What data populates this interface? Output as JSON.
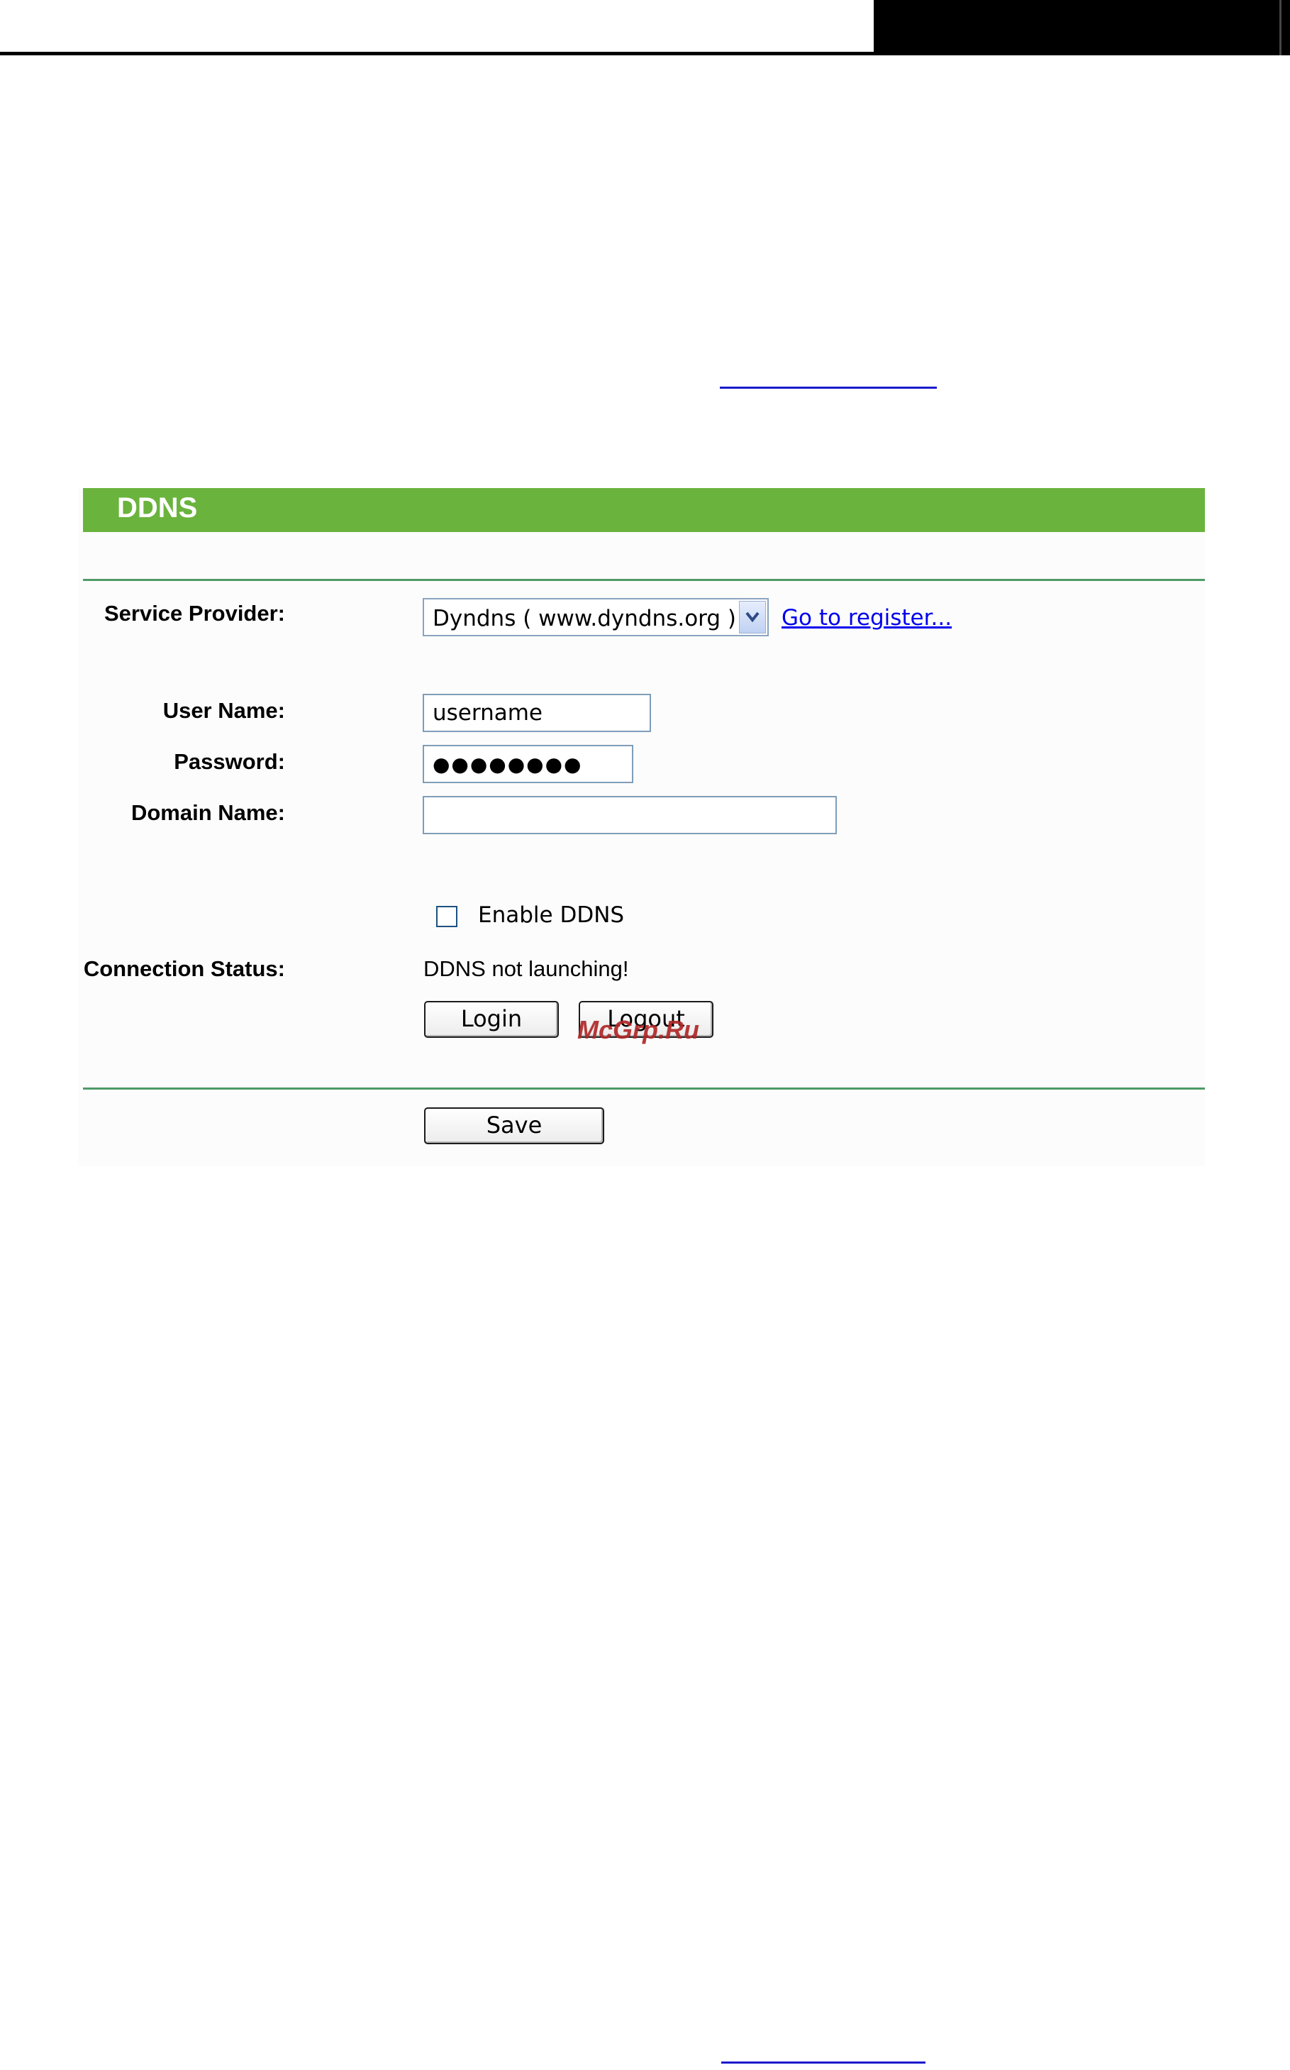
{
  "panel": {
    "title": "DDNS"
  },
  "form": {
    "service_provider": {
      "label": "Service Provider:",
      "value": "Dyndns ( www.dyndns.org )",
      "register_link": "Go to register..."
    },
    "user_name": {
      "label": "User Name:",
      "value": "username"
    },
    "password": {
      "label": "Password:",
      "masked_value": "●●●●●●●●"
    },
    "domain_name": {
      "label": "Domain Name:",
      "value": ""
    },
    "enable_ddns": {
      "label": "Enable DDNS",
      "checked": false
    },
    "connection_status": {
      "label": "Connection Status:",
      "value": "DDNS not launching!"
    },
    "buttons": {
      "login": "Login",
      "logout": "Logout",
      "save": "Save"
    }
  },
  "watermark": "McGrp.Ru",
  "colors": {
    "header": "#6ab33d",
    "divider": "#4f9a68",
    "link": "#0000ee",
    "watermark": "#b02828"
  }
}
